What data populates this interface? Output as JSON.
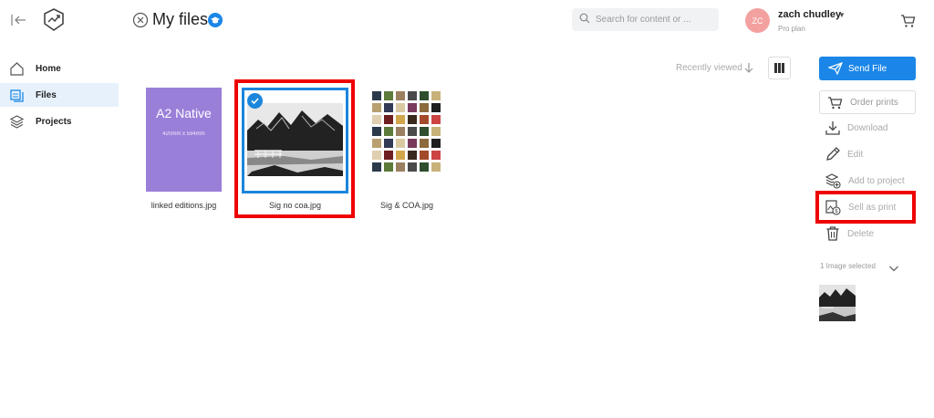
{
  "header": {
    "page_title": "My files",
    "search_placeholder": "Search for content or ...",
    "user": {
      "initials": "ZC",
      "name": "zach chudley",
      "plan": "Pro plan"
    }
  },
  "sidebar": {
    "items": [
      {
        "label": "Home",
        "icon": "home-icon",
        "active": false
      },
      {
        "label": "Files",
        "icon": "files-icon",
        "active": true
      },
      {
        "label": "Projects",
        "icon": "layers-icon",
        "active": false
      }
    ]
  },
  "toolbar": {
    "sort_label": "Recently viewed"
  },
  "files": [
    {
      "name": "linked editions.jpg",
      "thumb_title": "A2 Native",
      "thumb_subtitle": "420mm x 594mm",
      "selected": false
    },
    {
      "name": "Sig no coa.jpg",
      "selected": true
    },
    {
      "name": "Sig & COA.jpg",
      "selected": false
    }
  ],
  "actions": {
    "send_file": "Send File",
    "order_prints": "Order prints",
    "download": "Download",
    "edit": "Edit",
    "add_to_project": "Add to project",
    "sell_as_print": "Sell as print",
    "delete": "Delete"
  },
  "selection": {
    "summary": "1 Image selected"
  },
  "colors": {
    "accent": "#1b86e8",
    "highlight": "#e00000",
    "sidebar_active": "#e6f1fb",
    "a2_thumb": "#9a7fd9",
    "avatar": "#f3a1a0"
  }
}
